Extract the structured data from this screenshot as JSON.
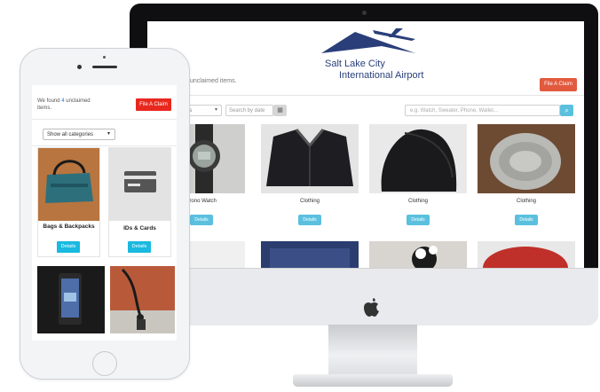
{
  "desktop": {
    "logo": {
      "line1": "Salt Lake City",
      "line2": "International Airport"
    },
    "found_text": "unclaimed items.",
    "claim_button": "File A Claim",
    "category_select": "es",
    "date_placeholder": "Search by date",
    "search_placeholder": "e.g. Watch, Sweater, Phone, Wallet...",
    "items": [
      {
        "label": "ck Chrono Watch",
        "button": "Details"
      },
      {
        "label": "Clothing",
        "button": "Details"
      },
      {
        "label": "Clothing",
        "button": "Details"
      },
      {
        "label": "Clothing",
        "button": "Details"
      }
    ]
  },
  "mobile": {
    "found_prefix": "We found",
    "found_count": "4",
    "found_suffix": "unclaimed items.",
    "claim_button": "File A Claim",
    "category_select": "Show all categories",
    "items": [
      {
        "label": "Bags & Backpacks",
        "button": "Details"
      },
      {
        "label": "IDs & Cards",
        "button": "Details"
      }
    ]
  },
  "colors": {
    "accent": "#5bc0de",
    "claim": "#e8281e",
    "logo": "#2a3f7a"
  },
  "icons": {
    "apple": "apple-icon",
    "calendar": "calendar-icon",
    "search": "search-icon"
  }
}
